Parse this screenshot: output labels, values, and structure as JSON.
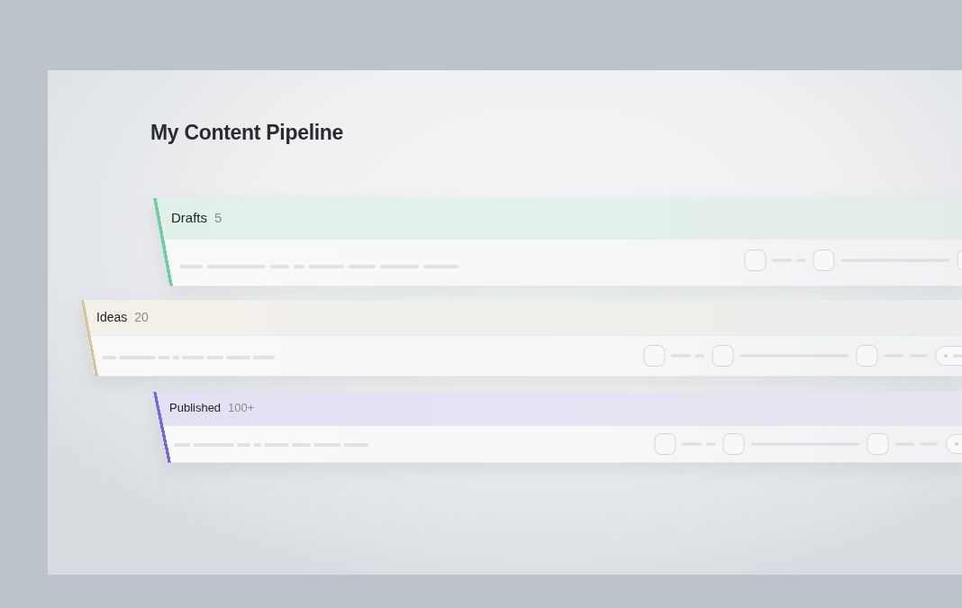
{
  "title": "My Content Pipeline",
  "stages": [
    {
      "label": "Drafts",
      "count": "5",
      "color": "#6ccfa3"
    },
    {
      "label": "Ideas",
      "count": "20",
      "color": "#d6c596"
    },
    {
      "label": "Published",
      "count": "100+",
      "color": "#7466e0"
    }
  ]
}
